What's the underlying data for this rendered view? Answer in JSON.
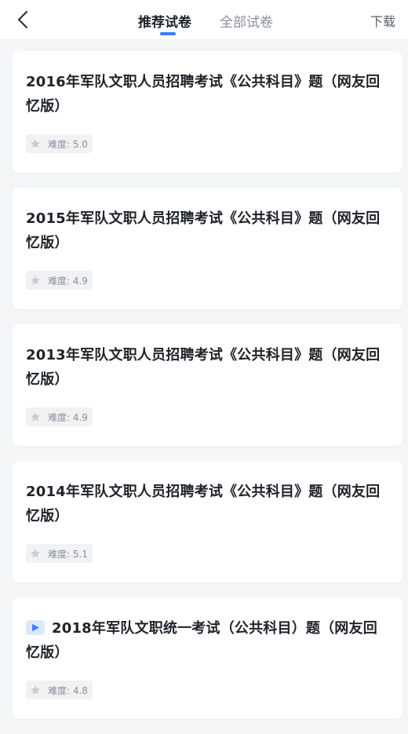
{
  "header": {
    "tabs": [
      {
        "label": "推荐试卷",
        "active": true
      },
      {
        "label": "全部试卷",
        "active": false
      }
    ],
    "download_label": "下载",
    "back_icon": "chevron-left-icon"
  },
  "colors": {
    "accent": "#3c7cfc",
    "title_text": "#1f2329",
    "muted_text": "#8a8f99",
    "background": "#f5f6f8"
  },
  "papers": [
    {
      "title": "2016年军队文职人员招聘考试《公共科目》题（网友回忆版）",
      "difficulty": "难度: 5.0",
      "video": false
    },
    {
      "title": "2015年军队文职人员招聘考试《公共科目》题（网友回忆版）",
      "difficulty": "难度: 4.9",
      "video": false
    },
    {
      "title": "2013年军队文职人员招聘考试《公共科目》题（网友回忆版）",
      "difficulty": "难度: 4.9",
      "video": false
    },
    {
      "title": "2014年军队文职人员招聘考试《公共科目》题（网友回忆版）",
      "difficulty": "难度: 5.1",
      "video": false
    },
    {
      "title": "2018年军队文职统一考试（公共科目）题（网友回忆版）",
      "difficulty": "难度: 4.8",
      "video": true
    }
  ]
}
